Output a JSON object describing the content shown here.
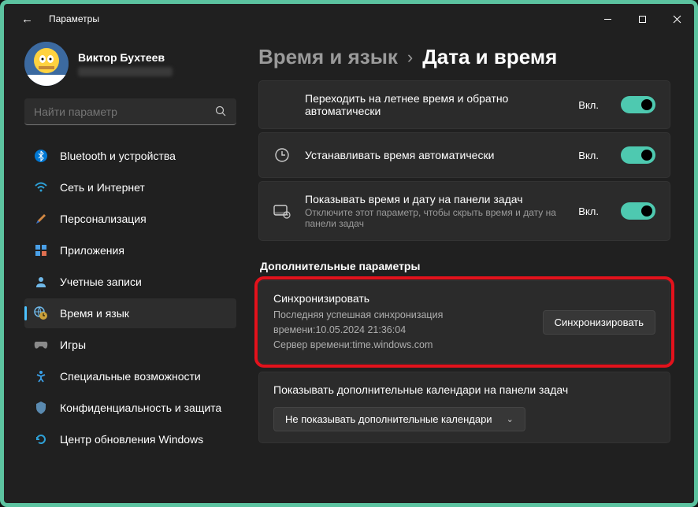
{
  "app_title": "Параметры",
  "user": {
    "name": "Виктор Бухтеев"
  },
  "search": {
    "placeholder": "Найти параметр"
  },
  "sidebar": {
    "items": [
      {
        "label": "Bluetooth и устройства"
      },
      {
        "label": "Сеть и Интернет"
      },
      {
        "label": "Персонализация"
      },
      {
        "label": "Приложения"
      },
      {
        "label": "Учетные записи"
      },
      {
        "label": "Время и язык"
      },
      {
        "label": "Игры"
      },
      {
        "label": "Специальные возможности"
      },
      {
        "label": "Конфиденциальность и защита"
      },
      {
        "label": "Центр обновления Windows"
      }
    ]
  },
  "breadcrumb": {
    "parent": "Время и язык",
    "sep": "›",
    "current": "Дата и время"
  },
  "cards": {
    "dst": {
      "title": "Переходить на летнее время и обратно автоматически",
      "state": "Вкл."
    },
    "autotime": {
      "title": "Устанавливать время автоматически",
      "state": "Вкл."
    },
    "taskbar": {
      "title": "Показывать время и дату на панели задач",
      "sub": "Отключите этот параметр, чтобы скрыть время и дату на панели задач",
      "state": "Вкл."
    }
  },
  "section_additional": "Дополнительные параметры",
  "sync": {
    "title": "Синхронизировать",
    "line1": "Последняя успешная синхронизация времени:10.05.2024 21:36:04",
    "line2": "Сервер времени:time.windows.com",
    "button": "Синхронизировать"
  },
  "calendars": {
    "title": "Показывать дополнительные календари на панели задач",
    "selected": "Не показывать дополнительные календари"
  }
}
